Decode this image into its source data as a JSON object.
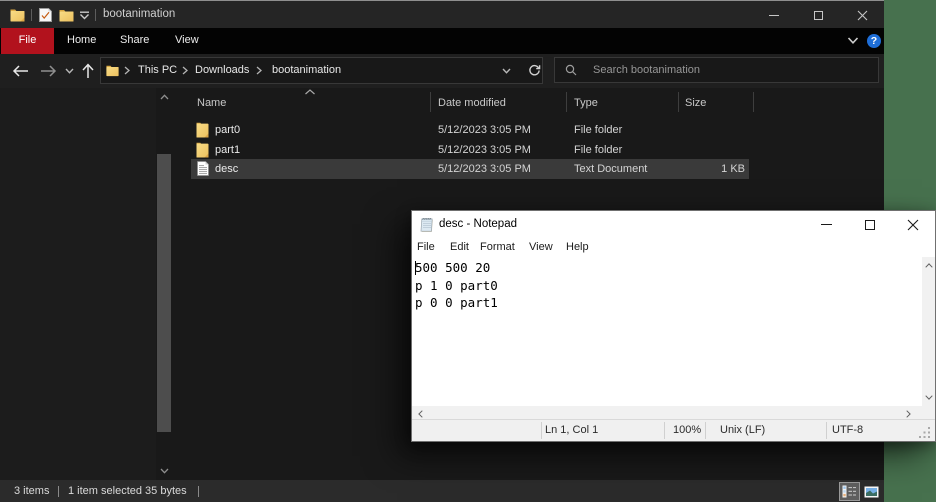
{
  "desktop": {
    "wallpaper_color": "#47714e"
  },
  "explorer": {
    "window_title": "bootanimation",
    "titlebar_icons": [
      "folder-icon",
      "properties-check-icon",
      "new-folder-icon",
      "qat-dropdown-icon"
    ],
    "caption_buttons": [
      "minimize",
      "maximize",
      "close"
    ],
    "ribbon": {
      "tabs": [
        "File",
        "Home",
        "Share",
        "View"
      ],
      "file_tab_color": "#b2121d",
      "right_icons": [
        "collapse-ribbon-chevron",
        "help"
      ]
    },
    "address_bar": {
      "nav_icons": [
        "back",
        "forward",
        "recent-locations",
        "up"
      ],
      "crumbs": [
        "This PC",
        "Downloads",
        "bootanimation"
      ],
      "right_icons": [
        "previous-locations-chevron",
        "refresh"
      ]
    },
    "search": {
      "placeholder": "Search bootanimation"
    },
    "columns": {
      "name": "Name",
      "date": "Date modified",
      "type": "Type",
      "size": "Size"
    },
    "files": [
      {
        "name": "part0",
        "date": "5/12/2023 3:05 PM",
        "type": "File folder",
        "size": "",
        "icon": "folder",
        "selected": false
      },
      {
        "name": "part1",
        "date": "5/12/2023 3:05 PM",
        "type": "File folder",
        "size": "",
        "icon": "folder",
        "selected": false
      },
      {
        "name": "desc",
        "date": "5/12/2023 3:05 PM",
        "type": "Text Document",
        "size": "1 KB",
        "icon": "text-file",
        "selected": true
      }
    ],
    "statusbar": {
      "items_count": "3 items",
      "selection_info": "1 item selected 35 bytes",
      "view_buttons": [
        "details-view",
        "thumbnails-view"
      ]
    }
  },
  "notepad": {
    "window_title": "desc - Notepad",
    "caption_buttons": [
      "minimize",
      "maximize",
      "close"
    ],
    "menus": [
      "File",
      "Edit",
      "Format",
      "View",
      "Help"
    ],
    "content_lines": [
      "500 500 20",
      "p 1 0 part0",
      "p 0 0 part1"
    ],
    "content_text": "500 500 20\np 1 0 part0\np 0 0 part1",
    "statusbar": {
      "cursor_position": "Ln 1, Col 1",
      "zoom": "100%",
      "line_ending": "Unix (LF)",
      "encoding": "UTF-8"
    }
  }
}
